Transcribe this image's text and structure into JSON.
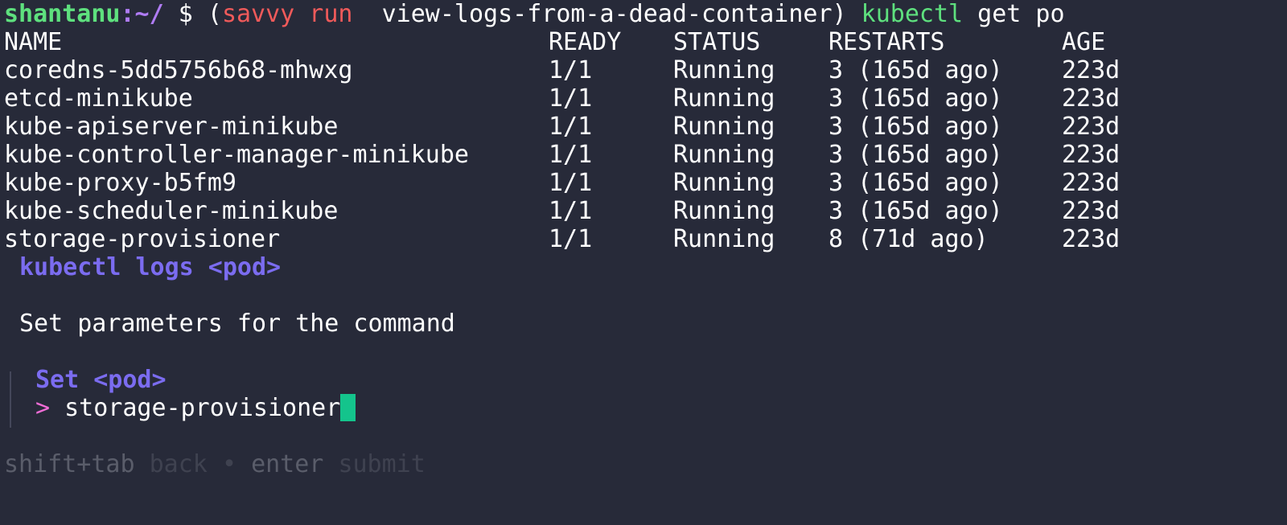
{
  "prompt": {
    "user": "shantanu",
    "path": ":~/",
    "symbol": " $ ",
    "paren_open": "(",
    "savvy_run": "savvy run",
    "runbook": "  view-logs-from-a-dead-container)",
    "kubectl": "kubectl",
    "command_rest": " get po"
  },
  "table": {
    "headers": [
      "NAME",
      "READY",
      "STATUS",
      "RESTARTS",
      "AGE"
    ],
    "rows": [
      [
        "coredns-5dd5756b68-mhwxg",
        "1/1",
        "Running",
        "3 (165d ago)",
        "223d"
      ],
      [
        "etcd-minikube",
        "1/1",
        "Running",
        "3 (165d ago)",
        "223d"
      ],
      [
        "kube-apiserver-minikube",
        "1/1",
        "Running",
        "3 (165d ago)",
        "223d"
      ],
      [
        "kube-controller-manager-minikube",
        "1/1",
        "Running",
        "3 (165d ago)",
        "223d"
      ],
      [
        "kube-proxy-b5fm9",
        "1/1",
        "Running",
        "3 (165d ago)",
        "223d"
      ],
      [
        "kube-scheduler-minikube",
        "1/1",
        "Running",
        "3 (165d ago)",
        "223d"
      ],
      [
        "storage-provisioner",
        "1/1",
        "Running",
        "8 (71d ago)",
        "223d"
      ]
    ]
  },
  "form": {
    "step_title": "kubectl logs <pod>",
    "description": "Set parameters for the command",
    "field_label": "Set <pod>",
    "input_prompt": ">",
    "input_value": "storage-provisioner"
  },
  "help": {
    "back_key": "shift+tab",
    "back_desc": "back",
    "separator": "•",
    "submit_key": "enter",
    "submit_desc": "submit"
  },
  "colors": {
    "background": "#272a39",
    "green": "#5ee07e",
    "purple": "#7b6cf0",
    "red": "#ef5a5a",
    "magenta": "#f06dd6",
    "cursor": "#14c48c"
  }
}
